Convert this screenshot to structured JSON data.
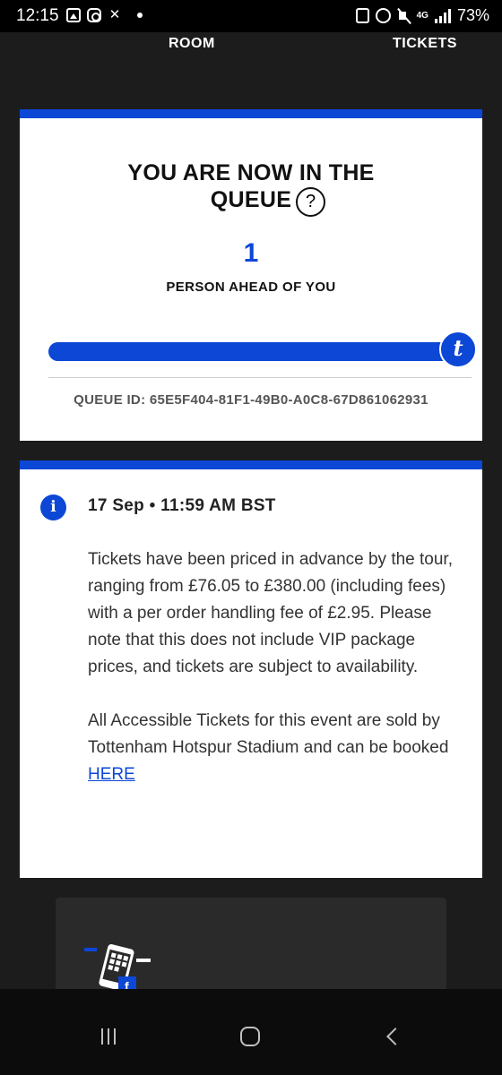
{
  "status_bar": {
    "time": "12:15",
    "battery": "73%",
    "network": "4G",
    "left_icons": [
      "gallery-icon",
      "instagram-icon",
      "x-icon",
      "notification-dot"
    ],
    "right_icons": [
      "recycle-icon",
      "alarm-icon",
      "mute-icon",
      "network-icon",
      "signal-icon",
      "battery-icon"
    ]
  },
  "top_nav": {
    "left_label": "ROOM",
    "right_label": "TICKETS"
  },
  "queue": {
    "title": "YOU ARE NOW IN THE QUEUE",
    "help_glyph": "?",
    "people_ahead": "1",
    "ahead_label": "PERSON AHEAD OF YOU",
    "progress": 0.97,
    "progress_logo": "t",
    "queue_id": "QUEUE ID: 65E5F404-81F1-49B0-A0C8-67D861062931",
    "accent_color": "#0c47d6"
  },
  "info": {
    "icon_glyph": "i",
    "date": "17 Sep • 11:59 AM BST",
    "paragraph1": "Tickets have been priced in advance by the tour, ranging from £76.05 to £380.00 (including fees) with a per order handling fee of £2.95. Please note that this does not include VIP package prices, and tickets are subject to availability.",
    "paragraph2_prefix": "All Accessible Tickets for this event are sold by Tottenham Hotspur Stadium and can be booked ",
    "paragraph2_link": "HERE"
  },
  "promo": {
    "icon": "phone-tickets-icon"
  },
  "nav_bar": {
    "buttons": [
      "recent-apps",
      "home",
      "back"
    ]
  }
}
